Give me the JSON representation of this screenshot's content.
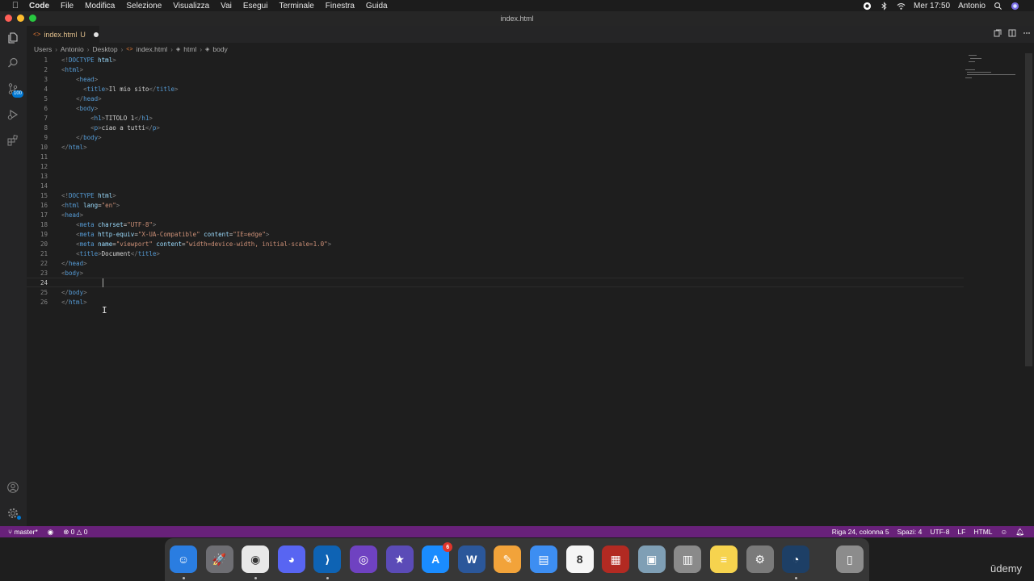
{
  "menubar": {
    "app_name": "Code",
    "items": [
      "File",
      "Modifica",
      "Selezione",
      "Visualizza",
      "Vai",
      "Esegui",
      "Terminale",
      "Finestra",
      "Guida"
    ],
    "clock": "Mer 17:50",
    "user": "Antonio"
  },
  "window": {
    "title": "index.html"
  },
  "activity": {
    "scm_badge": "100"
  },
  "tab": {
    "name": "index.html",
    "flag": "U"
  },
  "breadcrumb": [
    "Users",
    "Antonio",
    "Desktop",
    "index.html",
    "html",
    "body"
  ],
  "editor": {
    "current_line": 24,
    "lines": [
      {
        "n": "1",
        "indent": "",
        "parts": [
          [
            "br",
            "<!"
          ],
          [
            "tag",
            "DOCTYPE"
          ],
          [
            "txt",
            " "
          ],
          [
            "attr",
            "html"
          ],
          [
            "br",
            ">"
          ]
        ]
      },
      {
        "n": "2",
        "indent": "",
        "parts": [
          [
            "br",
            "<"
          ],
          [
            "tag",
            "html"
          ],
          [
            "br",
            ">"
          ]
        ]
      },
      {
        "n": "3",
        "indent": "    ",
        "parts": [
          [
            "br",
            "<"
          ],
          [
            "tag",
            "head"
          ],
          [
            "br",
            ">"
          ]
        ]
      },
      {
        "n": "4",
        "indent": "      ",
        "parts": [
          [
            "br",
            "<"
          ],
          [
            "tag",
            "title"
          ],
          [
            "br",
            ">"
          ],
          [
            "txt",
            "Il mio sito"
          ],
          [
            "br",
            "</"
          ],
          [
            "tag",
            "title"
          ],
          [
            "br",
            ">"
          ]
        ]
      },
      {
        "n": "5",
        "indent": "    ",
        "parts": [
          [
            "br",
            "</"
          ],
          [
            "tag",
            "head"
          ],
          [
            "br",
            ">"
          ]
        ]
      },
      {
        "n": "6",
        "indent": "    ",
        "parts": [
          [
            "br",
            "<"
          ],
          [
            "tag",
            "body"
          ],
          [
            "br",
            ">"
          ]
        ]
      },
      {
        "n": "7",
        "indent": "        ",
        "parts": [
          [
            "br",
            "<"
          ],
          [
            "tag",
            "h1"
          ],
          [
            "br",
            ">"
          ],
          [
            "txt",
            "TITOLO 1"
          ],
          [
            "br",
            "</"
          ],
          [
            "tag",
            "h1"
          ],
          [
            "br",
            ">"
          ]
        ]
      },
      {
        "n": "8",
        "indent": "        ",
        "parts": [
          [
            "br",
            "<"
          ],
          [
            "tag",
            "p"
          ],
          [
            "br",
            ">"
          ],
          [
            "txt",
            "ciao a tutti"
          ],
          [
            "br",
            "</"
          ],
          [
            "tag",
            "p"
          ],
          [
            "br",
            ">"
          ]
        ]
      },
      {
        "n": "9",
        "indent": "    ",
        "parts": [
          [
            "br",
            "</"
          ],
          [
            "tag",
            "body"
          ],
          [
            "br",
            ">"
          ]
        ]
      },
      {
        "n": "10",
        "indent": "",
        "parts": [
          [
            "br",
            "</"
          ],
          [
            "tag",
            "html"
          ],
          [
            "br",
            ">"
          ]
        ]
      },
      {
        "n": "11",
        "indent": "",
        "parts": []
      },
      {
        "n": "12",
        "indent": "",
        "parts": []
      },
      {
        "n": "13",
        "indent": "",
        "parts": []
      },
      {
        "n": "14",
        "indent": "",
        "parts": []
      },
      {
        "n": "15",
        "indent": "",
        "parts": [
          [
            "br",
            "<!"
          ],
          [
            "tag",
            "DOCTYPE"
          ],
          [
            "txt",
            " "
          ],
          [
            "attr",
            "html"
          ],
          [
            "br",
            ">"
          ]
        ]
      },
      {
        "n": "16",
        "indent": "",
        "parts": [
          [
            "br",
            "<"
          ],
          [
            "tag",
            "html"
          ],
          [
            "txt",
            " "
          ],
          [
            "attr",
            "lang"
          ],
          [
            "txt",
            "="
          ],
          [
            "str",
            "\"en\""
          ],
          [
            "br",
            ">"
          ]
        ]
      },
      {
        "n": "17",
        "indent": "",
        "parts": [
          [
            "br",
            "<"
          ],
          [
            "tag",
            "head"
          ],
          [
            "br",
            ">"
          ]
        ]
      },
      {
        "n": "18",
        "indent": "    ",
        "parts": [
          [
            "br",
            "<"
          ],
          [
            "tag",
            "meta"
          ],
          [
            "txt",
            " "
          ],
          [
            "attr",
            "charset"
          ],
          [
            "txt",
            "="
          ],
          [
            "str",
            "\"UTF-8\""
          ],
          [
            "br",
            ">"
          ]
        ]
      },
      {
        "n": "19",
        "indent": "    ",
        "parts": [
          [
            "br",
            "<"
          ],
          [
            "tag",
            "meta"
          ],
          [
            "txt",
            " "
          ],
          [
            "attr",
            "http-equiv"
          ],
          [
            "txt",
            "="
          ],
          [
            "str",
            "\"X-UA-Compatible\""
          ],
          [
            "txt",
            " "
          ],
          [
            "attr",
            "content"
          ],
          [
            "txt",
            "="
          ],
          [
            "str",
            "\"IE=edge\""
          ],
          [
            "br",
            ">"
          ]
        ]
      },
      {
        "n": "20",
        "indent": "    ",
        "parts": [
          [
            "br",
            "<"
          ],
          [
            "tag",
            "meta"
          ],
          [
            "txt",
            " "
          ],
          [
            "attr",
            "name"
          ],
          [
            "txt",
            "="
          ],
          [
            "str",
            "\"viewport\""
          ],
          [
            "txt",
            " "
          ],
          [
            "attr",
            "content"
          ],
          [
            "txt",
            "="
          ],
          [
            "str",
            "\"width=device-width, initial-scale=1.0\""
          ],
          [
            "br",
            ">"
          ]
        ]
      },
      {
        "n": "21",
        "indent": "    ",
        "parts": [
          [
            "br",
            "<"
          ],
          [
            "tag",
            "title"
          ],
          [
            "br",
            ">"
          ],
          [
            "txt",
            "Document"
          ],
          [
            "br",
            "</"
          ],
          [
            "tag",
            "title"
          ],
          [
            "br",
            ">"
          ]
        ]
      },
      {
        "n": "22",
        "indent": "",
        "parts": [
          [
            "br",
            "</"
          ],
          [
            "tag",
            "head"
          ],
          [
            "br",
            ">"
          ]
        ]
      },
      {
        "n": "23",
        "indent": "",
        "parts": [
          [
            "br",
            "<"
          ],
          [
            "tag",
            "body"
          ],
          [
            "br",
            ">"
          ]
        ]
      },
      {
        "n": "24",
        "indent": "    ",
        "parts": []
      },
      {
        "n": "25",
        "indent": "",
        "parts": [
          [
            "br",
            "</"
          ],
          [
            "tag",
            "body"
          ],
          [
            "br",
            ">"
          ]
        ]
      },
      {
        "n": "26",
        "indent": "",
        "parts": [
          [
            "br",
            "</"
          ],
          [
            "tag",
            "html"
          ],
          [
            "br",
            ">"
          ]
        ]
      }
    ]
  },
  "statusbar": {
    "branch": "master*",
    "problems": "0",
    "warnings": "0",
    "position": "Riga 24, colonna 5",
    "spaces": "Spazi: 4",
    "encoding": "UTF-8",
    "eol": "LF",
    "language": "HTML"
  },
  "dock": {
    "apps": [
      {
        "name": "finder",
        "color": "#2a7de1",
        "glyph": "☺"
      },
      {
        "name": "launchpad",
        "color": "#6e6e73",
        "glyph": "🚀"
      },
      {
        "name": "chrome",
        "color": "#e8e8e8",
        "glyph": "◉"
      },
      {
        "name": "discord",
        "color": "#5865f2",
        "glyph": "◕"
      },
      {
        "name": "vscode",
        "color": "#0e63b4",
        "glyph": "⟩"
      },
      {
        "name": "github-desktop",
        "color": "#6f42c1",
        "glyph": "◎"
      },
      {
        "name": "imovie",
        "color": "#5b4bb7",
        "glyph": "★"
      },
      {
        "name": "app-store",
        "color": "#1a8cff",
        "glyph": "A"
      },
      {
        "name": "word",
        "color": "#2b579a",
        "glyph": "W"
      },
      {
        "name": "pages",
        "color": "#f2a33a",
        "glyph": "✎"
      },
      {
        "name": "keynote",
        "color": "#3d8ef2",
        "glyph": "▤"
      },
      {
        "name": "calendar",
        "color": "#f5f5f5",
        "glyph": "8"
      },
      {
        "name": "photo-booth",
        "color": "#b22a22",
        "glyph": "▦"
      },
      {
        "name": "preview",
        "color": "#7f9fb5",
        "glyph": "▣"
      },
      {
        "name": "calculator",
        "color": "#8a8a8a",
        "glyph": "▥"
      },
      {
        "name": "notes",
        "color": "#f6d34e",
        "glyph": "≡"
      },
      {
        "name": "system-preferences",
        "color": "#7a7a7a",
        "glyph": "⚙"
      },
      {
        "name": "quicktime",
        "color": "#1d3f66",
        "glyph": "◔"
      },
      {
        "name": "trash",
        "color": "#8c8c8c",
        "glyph": "▯"
      }
    ],
    "app_store_badge": "6",
    "calendar_month": "SET",
    "calendar_day": "8"
  },
  "watermark": "ūdemy"
}
